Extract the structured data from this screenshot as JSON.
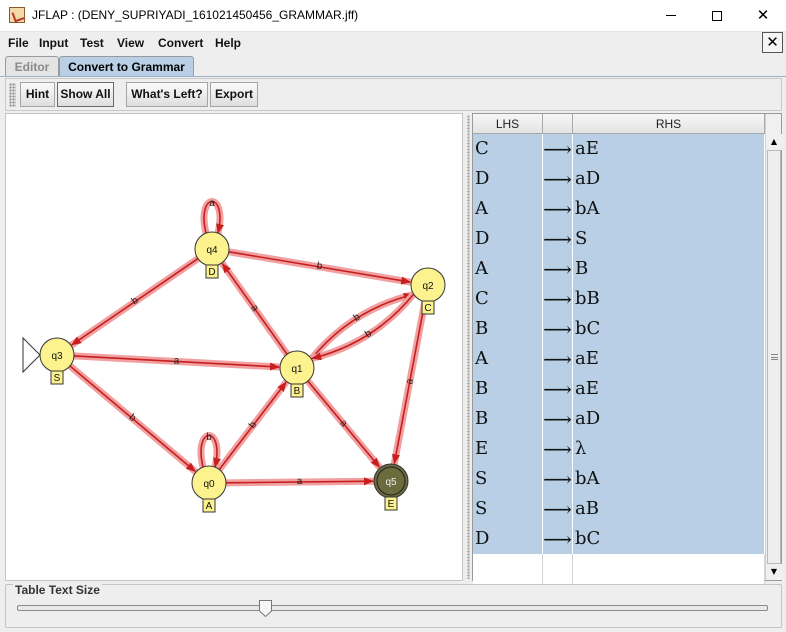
{
  "window": {
    "title": "JFLAP : (DENY_SUPRIYADI_161021450456_GRAMMAR.jff)",
    "minimize_glyph": "",
    "maximize_glyph": "",
    "close_glyph": "✕"
  },
  "menu": {
    "items": [
      "File",
      "Input",
      "Test",
      "View",
      "Convert",
      "Help"
    ],
    "close_doc_glyph": "✕"
  },
  "tabs": [
    {
      "label": "Editor"
    },
    {
      "label": "Convert to Grammar"
    }
  ],
  "toolbar": {
    "hint": "Hint",
    "show_all": "Show All",
    "whats_left": "What's Left?",
    "export": "Export"
  },
  "automaton": {
    "states": [
      {
        "id": "q0",
        "label": "A",
        "initial": false,
        "final": false,
        "highlight": false
      },
      {
        "id": "q1",
        "label": "B",
        "initial": false,
        "final": false,
        "highlight": false
      },
      {
        "id": "q2",
        "label": "C",
        "initial": false,
        "final": false,
        "highlight": false
      },
      {
        "id": "q3",
        "label": "S",
        "initial": true,
        "final": false,
        "highlight": false
      },
      {
        "id": "q4",
        "label": "D",
        "initial": false,
        "final": false,
        "highlight": false
      },
      {
        "id": "q5",
        "label": "E",
        "initial": false,
        "final": true,
        "highlight": true
      }
    ],
    "transitions": [
      {
        "from": "q4",
        "to": "q4",
        "symbol": "a"
      },
      {
        "from": "q4",
        "to": "q2",
        "symbol": "b"
      },
      {
        "from": "q4",
        "to": "q3",
        "symbol": "b"
      },
      {
        "from": "q1",
        "to": "q4",
        "symbol": "a"
      },
      {
        "from": "q3",
        "to": "q1",
        "symbol": "a"
      },
      {
        "from": "q3",
        "to": "q0",
        "symbol": "b"
      },
      {
        "from": "q1",
        "to": "q2",
        "symbol": "b"
      },
      {
        "from": "q2",
        "to": "q1",
        "symbol": "b"
      },
      {
        "from": "q2",
        "to": "q5",
        "symbol": "a"
      },
      {
        "from": "q1",
        "to": "q5",
        "symbol": "a"
      },
      {
        "from": "q0",
        "to": "q1",
        "symbol": "b"
      },
      {
        "from": "q0",
        "to": "q0",
        "symbol": "b"
      },
      {
        "from": "q0",
        "to": "q5",
        "symbol": "a"
      }
    ],
    "colors": {
      "state_fill": "#fcf38f",
      "final_fill": "#6b6b3e",
      "edge": "#c81e1e",
      "edge_glow": "#f0a0a0"
    }
  },
  "table": {
    "headers": {
      "lhs": "LHS",
      "arrow": "",
      "rhs": "RHS"
    },
    "arrow_glyph": "⟶",
    "rows": [
      {
        "lhs": "C",
        "rhs": "aE"
      },
      {
        "lhs": "D",
        "rhs": "aD"
      },
      {
        "lhs": "A",
        "rhs": "bA"
      },
      {
        "lhs": "D",
        "rhs": "S"
      },
      {
        "lhs": "A",
        "rhs": "B"
      },
      {
        "lhs": "C",
        "rhs": "bB"
      },
      {
        "lhs": "B",
        "rhs": "bC"
      },
      {
        "lhs": "A",
        "rhs": "aE"
      },
      {
        "lhs": "B",
        "rhs": "aE"
      },
      {
        "lhs": "B",
        "rhs": "aD"
      },
      {
        "lhs": "E",
        "rhs": "λ"
      },
      {
        "lhs": "S",
        "rhs": "bA"
      },
      {
        "lhs": "S",
        "rhs": "aB"
      },
      {
        "lhs": "D",
        "rhs": "bC"
      }
    ],
    "selection_color": "#b8cfe5"
  },
  "slider": {
    "label": "Table Text Size",
    "value_fraction": 0.33
  }
}
